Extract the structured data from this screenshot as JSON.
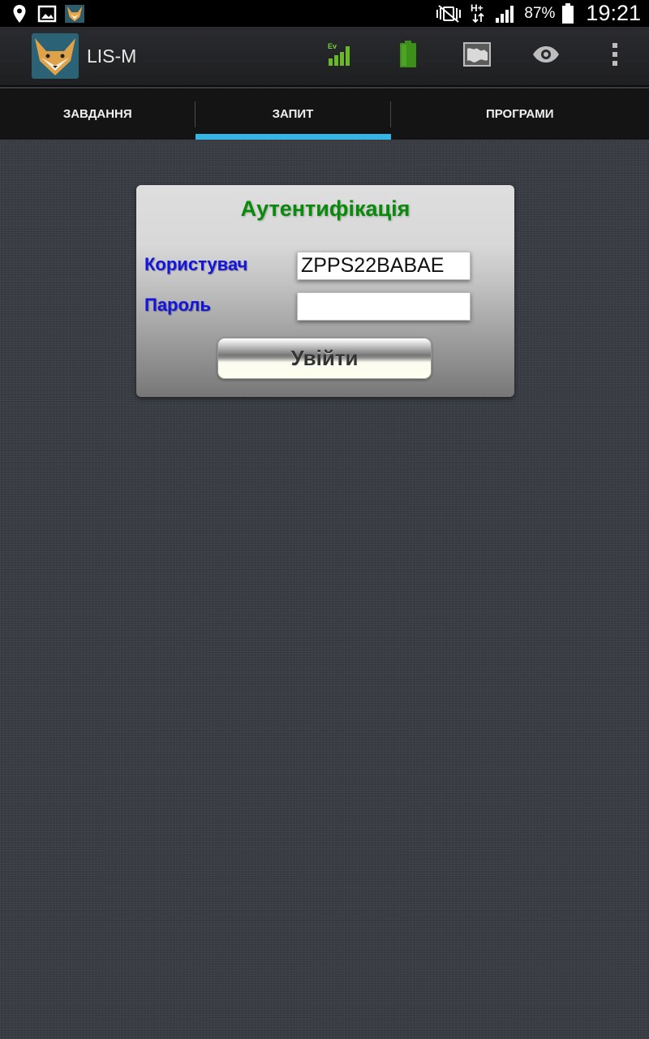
{
  "status_bar": {
    "battery_percent": "87%",
    "time": "19:21",
    "icons": [
      "location-icon",
      "gallery-icon",
      "app-notification-icon",
      "mute-vibrate-icon",
      "hplus-data-icon",
      "signal-icon",
      "battery-icon"
    ]
  },
  "action_bar": {
    "app_title": "LIS-M",
    "actions": [
      "ev-signal-icon",
      "battery-status-icon",
      "map-icon",
      "eye-icon",
      "overflow-menu-icon"
    ],
    "colors": {
      "signal_green": "#6ab82a",
      "battery_green": "#3c8f1a"
    }
  },
  "tabs": [
    {
      "label": "ЗАВДАННЯ",
      "selected": false
    },
    {
      "label": "ЗАПИТ",
      "selected": true
    },
    {
      "label": "ПРОГРАМИ",
      "selected": false
    }
  ],
  "tab_indicator_color": "#33b5e5",
  "auth": {
    "title": "Аутентифікація",
    "user_label": "Користувач",
    "user_value": "ZPPS22BABAE",
    "password_label": "Пароль",
    "password_value": "",
    "login_label": "Увійти",
    "colors": {
      "title": "#0a8a0a",
      "labels": "#1414e0"
    }
  }
}
